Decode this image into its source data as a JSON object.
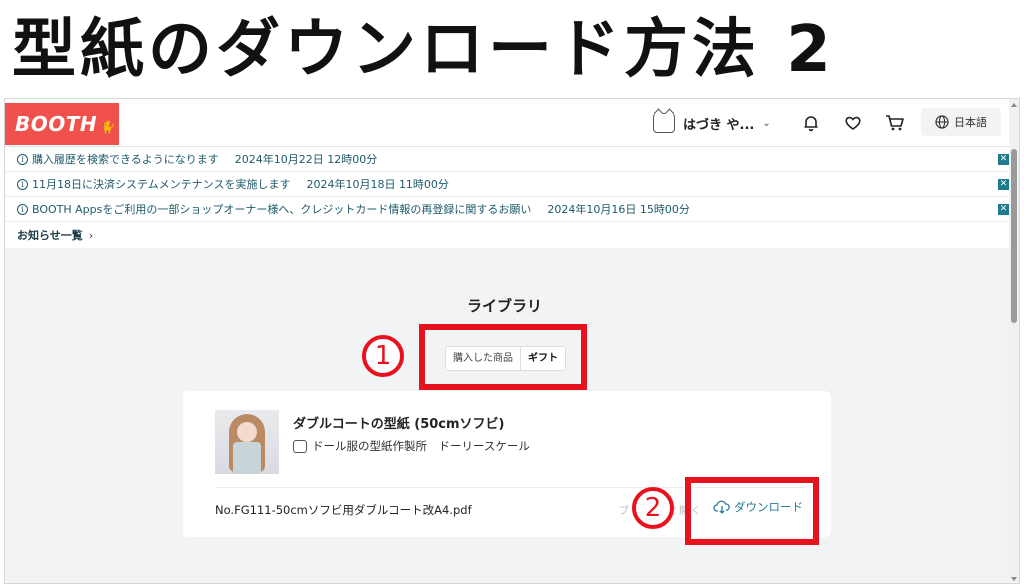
{
  "overlay": {
    "title": "型紙のダウンロード方法 2",
    "step1": "1",
    "step2": "2"
  },
  "header": {
    "logo": "BOOTH",
    "user_name": "はづき や...",
    "language": "日本語"
  },
  "notices": [
    {
      "text": "購入履歴を検索できるようになります",
      "date": "2024年10月22日 12時00分"
    },
    {
      "text": "11月18日に決済システムメンテナンスを実施します",
      "date": "2024年10月18日 11時00分"
    },
    {
      "text": "BOOTH Appsをご利用の一部ショップオーナー様へ、クレジットカード情報の再登録に関するお願い",
      "date": "2024年10月16日 15時00分"
    }
  ],
  "notice_more": "お知らせ一覧",
  "library": {
    "title": "ライブラリ",
    "tabs": [
      "購入した商品",
      "ギフト"
    ]
  },
  "product": {
    "title": "ダブルコートの型紙 (50cmソフビ)",
    "shop": "ドール服の型紙作製所　ドーリースケール",
    "file_name": "No.FG111-50cmソフビ用ダブルコート改A4.pdf",
    "open_in_browser": "ブラウザで開く",
    "download_label": "ダウンロード"
  },
  "colors": {
    "brand": "#f0514d",
    "annotation_red": "#e8121e",
    "link": "#2a7a9a"
  }
}
